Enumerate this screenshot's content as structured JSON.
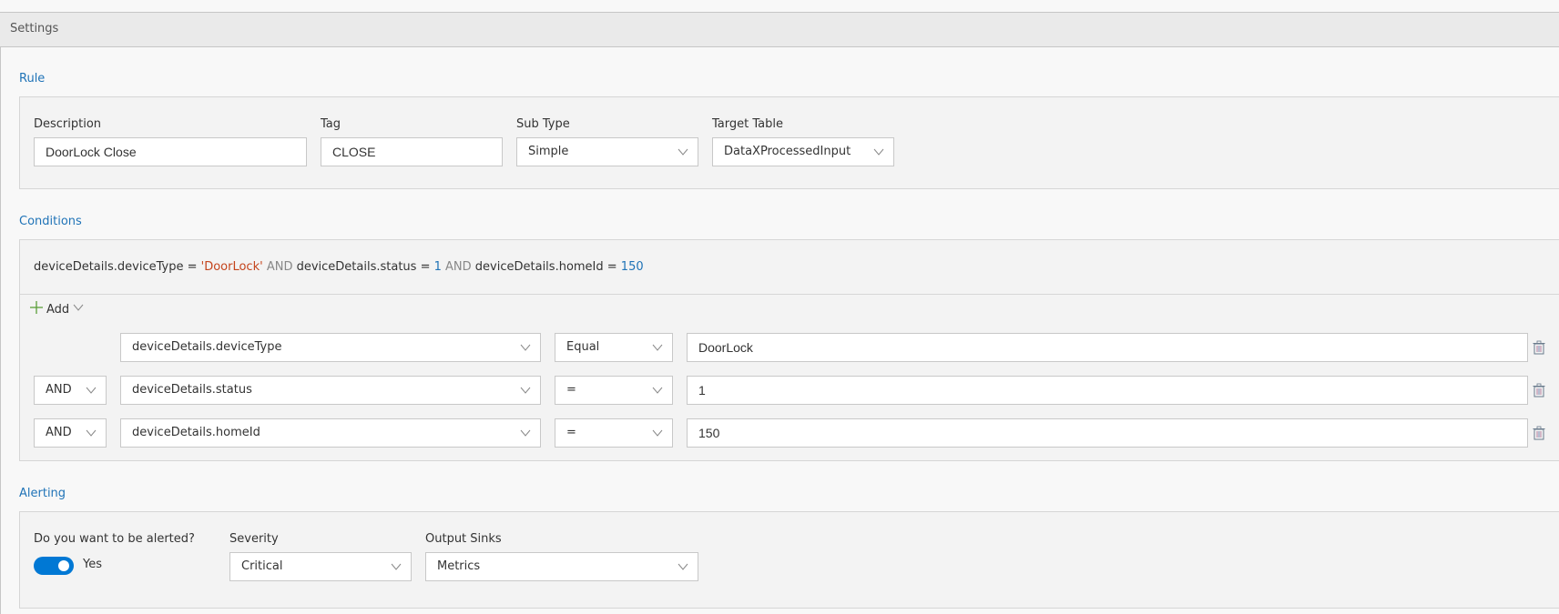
{
  "header": {
    "title": "Settings"
  },
  "rule": {
    "section_title": "Rule",
    "description": {
      "label": "Description",
      "value": "DoorLock Close"
    },
    "tag": {
      "label": "Tag",
      "value": "CLOSE"
    },
    "sub_type": {
      "label": "Sub Type",
      "value": "Simple"
    },
    "target_table": {
      "label": "Target Table",
      "value": "DataXProcessedInput"
    }
  },
  "conditions": {
    "section_title": "Conditions",
    "query": {
      "p1": "deviceDetails.deviceType = ",
      "v1": "'DoorLock'",
      "k1": " AND ",
      "p2": "deviceDetails.status = ",
      "v2": "1",
      "k2": " AND ",
      "p3": "deviceDetails.homeId = ",
      "v3": "150"
    },
    "add_label": "Add",
    "rows": [
      {
        "conjunction": "",
        "field": "deviceDetails.deviceType",
        "operator": "Equal",
        "value": "DoorLock"
      },
      {
        "conjunction": "AND",
        "field": "deviceDetails.status",
        "operator": "=",
        "value": "1"
      },
      {
        "conjunction": "AND",
        "field": "deviceDetails.homeId",
        "operator": "=",
        "value": "150"
      }
    ]
  },
  "alerting": {
    "section_title": "Alerting",
    "alert_question": "Do you want to be alerted?",
    "alert_enabled": true,
    "alert_toggle_label": "Yes",
    "severity": {
      "label": "Severity",
      "value": "Critical"
    },
    "output_sinks": {
      "label": "Output Sinks",
      "value": "Metrics"
    }
  },
  "colors": {
    "accent": "#0078d4",
    "link": "#1f73b7",
    "string": "#c4441c"
  }
}
